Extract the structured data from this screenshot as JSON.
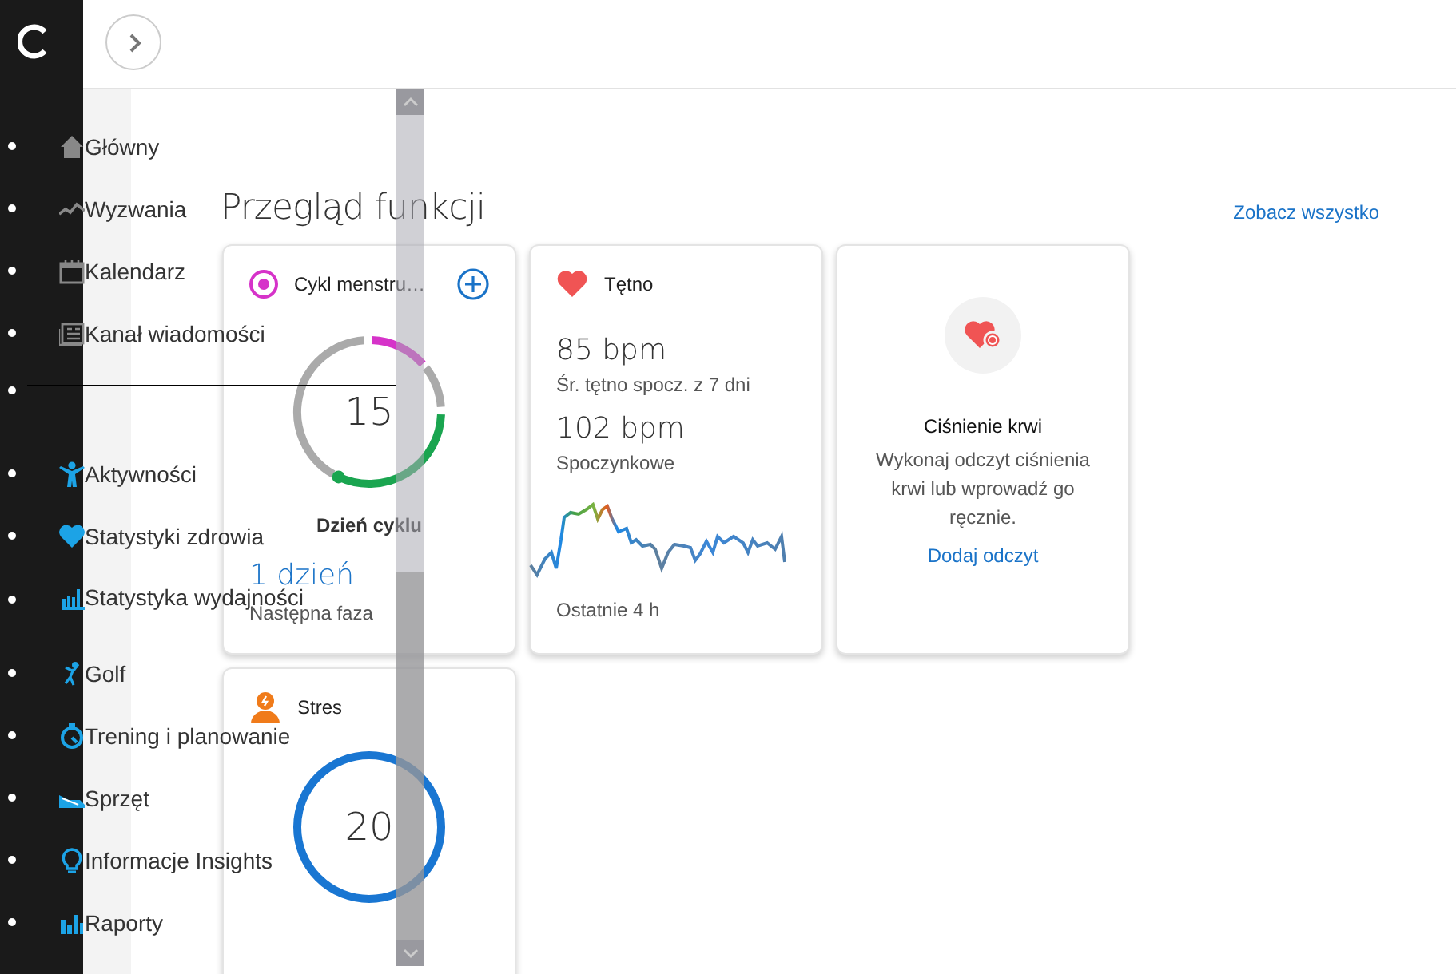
{
  "nav": {
    "items": [
      {
        "kind": "link",
        "label": "Główny"
      },
      {
        "kind": "link",
        "label": "Wyzwania"
      },
      {
        "kind": "link",
        "label": "Kalendarz"
      },
      {
        "kind": "link",
        "label": "Kanał wiadomości"
      },
      {
        "kind": "separator"
      },
      {
        "kind": "link",
        "label": "Aktywności"
      },
      {
        "kind": "link",
        "label": "Statystyki zdrowia"
      },
      {
        "kind": "link",
        "label": "Statystyka wydajności"
      },
      {
        "kind": "link",
        "label": "Golf"
      },
      {
        "kind": "link",
        "label": "Trening i planowanie"
      },
      {
        "kind": "link",
        "label": "Sprzęt"
      },
      {
        "kind": "link",
        "label": "Informacje Insights"
      },
      {
        "kind": "link",
        "label": "Raporty"
      }
    ]
  },
  "overview": {
    "title": "Przegląd funkcji",
    "see_all": "Zobacz wszystko",
    "cards": [
      {
        "kind": "cycle",
        "title": "Cykl menstru…",
        "value": "15",
        "caption": "Dzień cyklu",
        "next_value": "1 dzień",
        "next_label": "Następna faza"
      },
      {
        "kind": "heart_rate",
        "title": "Tętno",
        "readings": [
          {
            "value": "85 bpm",
            "label": "Śr. tętno spocz. z 7 dni"
          },
          {
            "value": "102 bpm",
            "label": "Spoczynkowe"
          }
        ],
        "footer": "Ostatnie 4 h"
      },
      {
        "kind": "blood_pressure",
        "title": "Ciśnienie krwi",
        "text": "Wykonaj odczyt ciśnienia krwi lub wprowadź go ręcznie.",
        "action": "Dodaj odczyt"
      },
      {
        "kind": "stress",
        "title": "Stres",
        "value": "20"
      }
    ]
  }
}
